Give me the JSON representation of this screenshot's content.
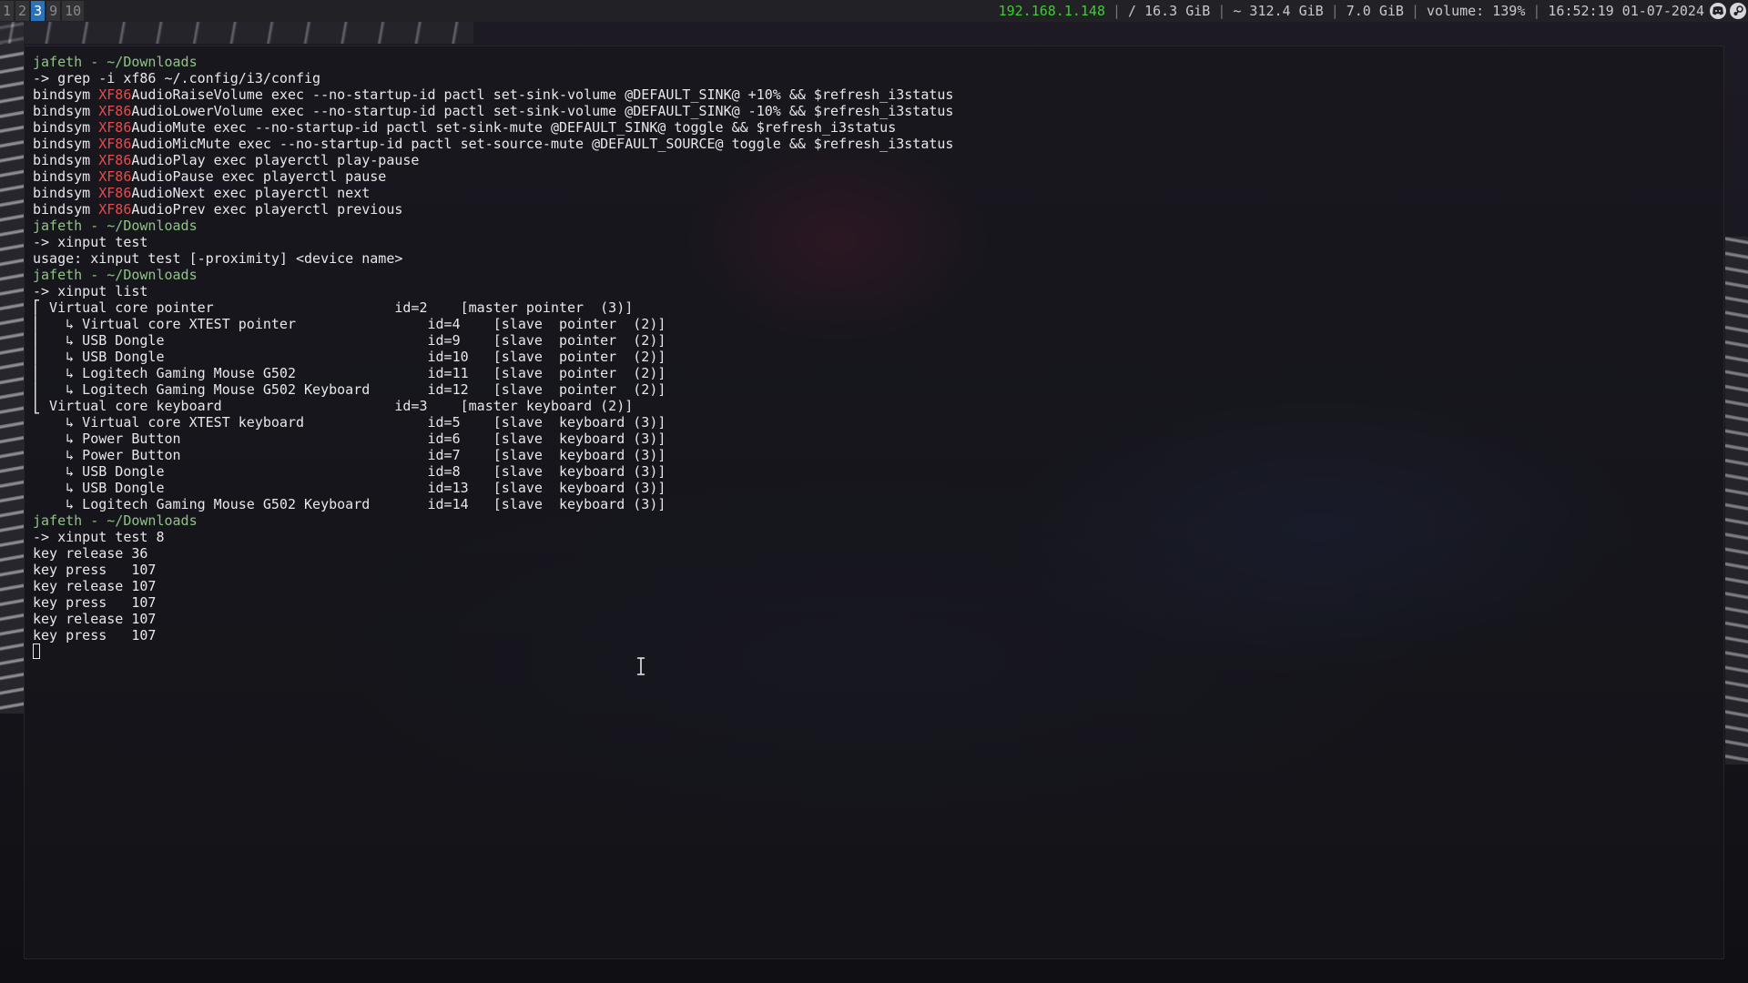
{
  "bar": {
    "workspaces": [
      {
        "label": "1",
        "focused": false
      },
      {
        "label": "2",
        "focused": false
      },
      {
        "label": "3",
        "focused": true
      },
      {
        "label": "9",
        "focused": false
      },
      {
        "label": "10",
        "focused": false
      }
    ],
    "status": {
      "ip": "192.168.1.148",
      "root_disk": "/ 16.3 GiB",
      "home_disk": "~ 312.4 GiB",
      "memory": "7.0 GiB",
      "volume": "volume: 139%",
      "datetime": "16:52:19 01-07-2024"
    },
    "separator": "|",
    "tray": [
      "discord-icon",
      "steam-icon"
    ],
    "colors": {
      "focused_ws": "#2b73b8",
      "ip": "#3dce2f"
    }
  },
  "terminal": {
    "prompt_color": "#8fc486",
    "highlight_color": "#e84a4a",
    "lines": [
      {
        "t": "prompt",
        "text": "jafeth - ~/Downloads"
      },
      {
        "t": "plain",
        "text": "-> grep -i xf86 ~/.config/i3/config"
      },
      {
        "t": "hl",
        "pre": "bindsym ",
        "hl": "XF86",
        "post": "AudioRaiseVolume exec --no-startup-id pactl set-sink-volume @DEFAULT_SINK@ +10% && $refresh_i3status"
      },
      {
        "t": "hl",
        "pre": "bindsym ",
        "hl": "XF86",
        "post": "AudioLowerVolume exec --no-startup-id pactl set-sink-volume @DEFAULT_SINK@ -10% && $refresh_i3status"
      },
      {
        "t": "hl",
        "pre": "bindsym ",
        "hl": "XF86",
        "post": "AudioMute exec --no-startup-id pactl set-sink-mute @DEFAULT_SINK@ toggle && $refresh_i3status"
      },
      {
        "t": "hl",
        "pre": "bindsym ",
        "hl": "XF86",
        "post": "AudioMicMute exec --no-startup-id pactl set-source-mute @DEFAULT_SOURCE@ toggle && $refresh_i3status"
      },
      {
        "t": "hl",
        "pre": "bindsym ",
        "hl": "XF86",
        "post": "AudioPlay exec playerctl play-pause"
      },
      {
        "t": "hl",
        "pre": "bindsym ",
        "hl": "XF86",
        "post": "AudioPause exec playerctl pause"
      },
      {
        "t": "hl",
        "pre": "bindsym ",
        "hl": "XF86",
        "post": "AudioNext exec playerctl next"
      },
      {
        "t": "hl",
        "pre": "bindsym ",
        "hl": "XF86",
        "post": "AudioPrev exec playerctl previous"
      },
      {
        "t": "prompt",
        "text": "jafeth - ~/Downloads"
      },
      {
        "t": "plain",
        "text": "-> xinput test"
      },
      {
        "t": "plain",
        "text": "usage: xinput test [-proximity] <device name>"
      },
      {
        "t": "prompt",
        "text": "jafeth - ~/Downloads"
      },
      {
        "t": "plain",
        "text": "-> xinput list"
      },
      {
        "t": "plain",
        "text": "⎡ Virtual core pointer                    \tid=2\t[master pointer  (3)]"
      },
      {
        "t": "plain",
        "text": "⎜   ↳ Virtual core XTEST pointer              \tid=4\t[slave  pointer  (2)]"
      },
      {
        "t": "plain",
        "text": "⎜   ↳ USB Dongle                              \tid=9\t[slave  pointer  (2)]"
      },
      {
        "t": "plain",
        "text": "⎜   ↳ USB Dongle                              \tid=10\t[slave  pointer  (2)]"
      },
      {
        "t": "plain",
        "text": "⎜   ↳ Logitech Gaming Mouse G502              \tid=11\t[slave  pointer  (2)]"
      },
      {
        "t": "plain",
        "text": "⎜   ↳ Logitech Gaming Mouse G502 Keyboard     \tid=12\t[slave  pointer  (2)]"
      },
      {
        "t": "plain",
        "text": "⎣ Virtual core keyboard                   \tid=3\t[master keyboard (2)]"
      },
      {
        "t": "plain",
        "text": "    ↳ Virtual core XTEST keyboard             \tid=5\t[slave  keyboard (3)]"
      },
      {
        "t": "plain",
        "text": "    ↳ Power Button                            \tid=6\t[slave  keyboard (3)]"
      },
      {
        "t": "plain",
        "text": "    ↳ Power Button                            \tid=7\t[slave  keyboard (3)]"
      },
      {
        "t": "plain",
        "text": "    ↳ USB Dongle                              \tid=8\t[slave  keyboard (3)]"
      },
      {
        "t": "plain",
        "text": "    ↳ USB Dongle                              \tid=13\t[slave  keyboard (3)]"
      },
      {
        "t": "plain",
        "text": "    ↳ Logitech Gaming Mouse G502 Keyboard     \tid=14\t[slave  keyboard (3)]"
      },
      {
        "t": "prompt",
        "text": "jafeth - ~/Downloads"
      },
      {
        "t": "plain",
        "text": "-> xinput test 8"
      },
      {
        "t": "plain",
        "text": "key release 36"
      },
      {
        "t": "plain",
        "text": "key press   107"
      },
      {
        "t": "plain",
        "text": "key release 107"
      },
      {
        "t": "plain",
        "text": "key press   107"
      },
      {
        "t": "plain",
        "text": "key release 107"
      },
      {
        "t": "plain",
        "text": "key press   107"
      },
      {
        "t": "cursor"
      }
    ]
  }
}
